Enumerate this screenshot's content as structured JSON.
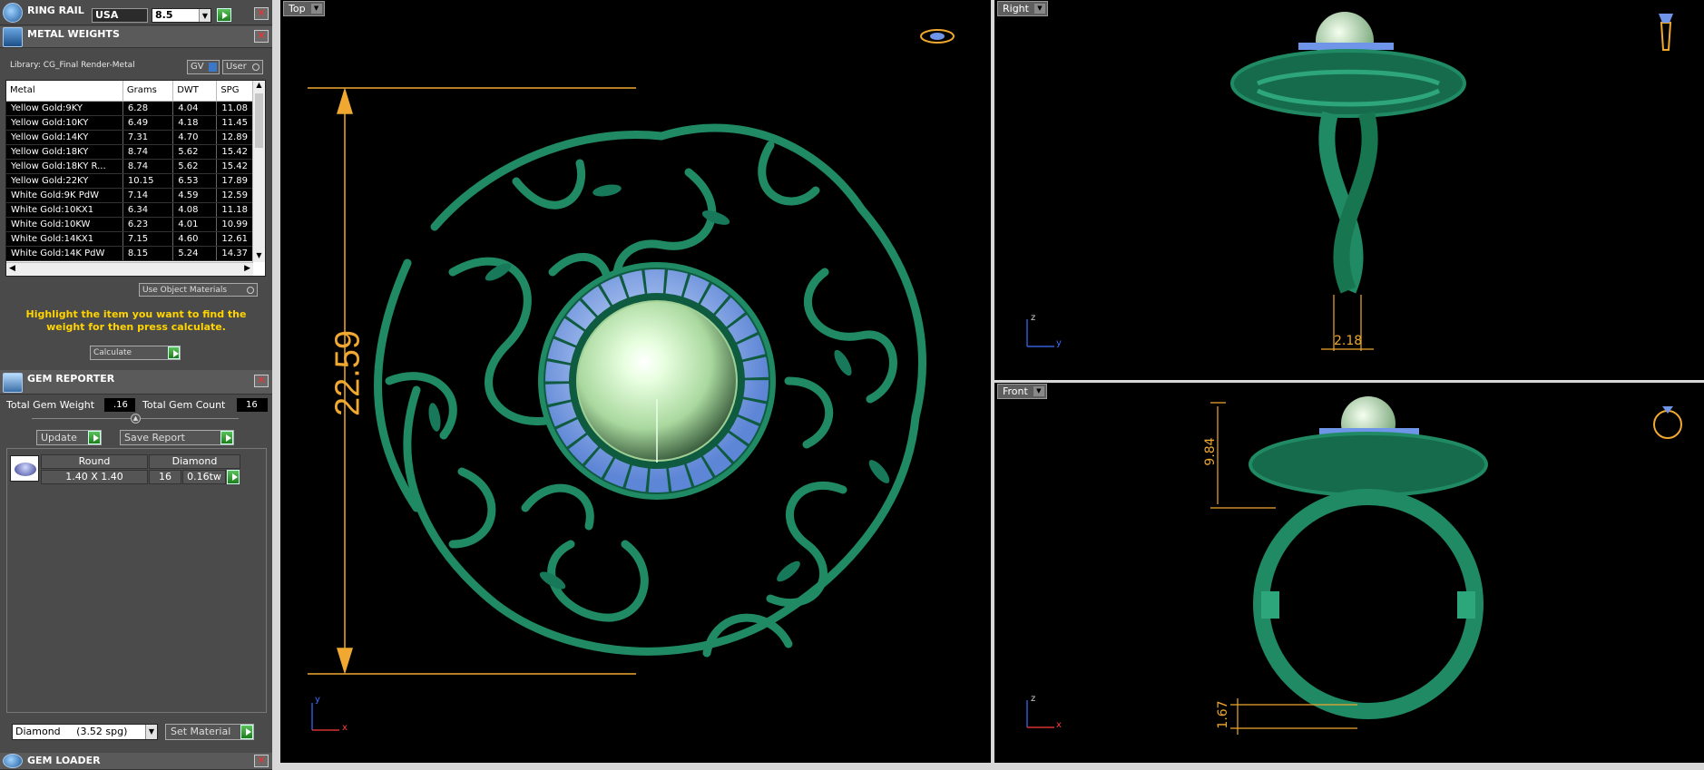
{
  "ring_rail": {
    "title": "RING RAIL",
    "country": "USA",
    "size": "8.5"
  },
  "metal_weights": {
    "title": "METAL WEIGHTS",
    "library": "Library: CG_Final Render-Metal",
    "gv_label": "GV",
    "user_label": "User",
    "columns": [
      "Metal",
      "Grams",
      "DWT",
      "SPG"
    ],
    "rows": [
      [
        "Yellow Gold:9KY",
        "6.28",
        "4.04",
        "11.08"
      ],
      [
        "Yellow Gold:10KY",
        "6.49",
        "4.18",
        "11.45"
      ],
      [
        "Yellow Gold:14KY",
        "7.31",
        "4.70",
        "12.89"
      ],
      [
        "Yellow Gold:18KY",
        "8.74",
        "5.62",
        "15.42"
      ],
      [
        "Yellow Gold:18KY R...",
        "8.74",
        "5.62",
        "15.42"
      ],
      [
        "Yellow Gold:22KY",
        "10.15",
        "6.53",
        "17.89"
      ],
      [
        "White Gold:9K PdW",
        "7.14",
        "4.59",
        "12.59"
      ],
      [
        "White Gold:10KX1",
        "6.34",
        "4.08",
        "11.18"
      ],
      [
        "White Gold:10KW",
        "6.23",
        "4.01",
        "10.99"
      ],
      [
        "White Gold:14KX1",
        "7.15",
        "4.60",
        "12.61"
      ],
      [
        "White Gold:14K PdW",
        "8.15",
        "5.24",
        "14.37"
      ]
    ],
    "use_object_materials": "Use Object Materials",
    "instruction": "Highlight the item you want to find the weight for then press calculate.",
    "calculate": "Calculate"
  },
  "gem_reporter": {
    "title": "GEM REPORTER",
    "total_gem_weight_label": "Total Gem Weight",
    "total_gem_weight": ".16",
    "total_gem_count_label": "Total Gem Count",
    "total_gem_count": "16",
    "update": "Update",
    "save_report": "Save Report",
    "gem": {
      "shape": "Round",
      "material": "Diamond",
      "size": "1.40 X 1.40",
      "count": "16",
      "weight": "0.16tw"
    },
    "material_select": "Diamond     (3.52 spg)",
    "set_material": "Set Material"
  },
  "gem_loader": {
    "title": "GEM LOADER"
  },
  "viewports": {
    "top": {
      "label": "Top",
      "dimension": "22.59",
      "axis_v": "y",
      "axis_h": "x"
    },
    "right": {
      "label": "Right",
      "dimension": "2.18",
      "axis_v": "z",
      "axis_h": "y"
    },
    "front": {
      "label": "Front",
      "dimension_top": "9.84",
      "dimension_bottom": "1.67",
      "axis_v": "z",
      "axis_h": "x"
    }
  },
  "colors": {
    "metal_green": "#1f8a63",
    "metal_dark": "#0b4a33",
    "gem_blue": "#8fb6f5",
    "pearl": "#cdeec2",
    "dimension_orange": "#f0a830",
    "instruction_yellow": "#ffd400"
  }
}
